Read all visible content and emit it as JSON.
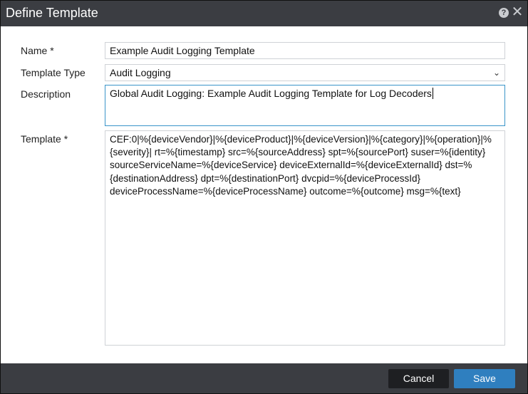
{
  "dialog": {
    "title": "Define Template",
    "help_icon": "question-circle-icon",
    "close_icon": "close-icon"
  },
  "form": {
    "name_label": "Name *",
    "name_value": "Example Audit Logging Template",
    "type_label": "Template Type",
    "type_value": "Audit Logging",
    "description_label": "Description",
    "description_value": "Global Audit Logging: Example Audit Logging Template for Log Decoders",
    "template_label": "Template *",
    "template_value": "CEF:0|%{deviceVendor}|%{deviceProduct}|%{deviceVersion}|%{category}|%{operation}|%{severity}| rt=%{timestamp} src=%{sourceAddress} spt=%{sourcePort} suser=%{identity} sourceServiceName=%{deviceService} deviceExternalId=%{deviceExternalId} dst=%{destinationAddress} dpt=%{destinationPort} dvcpid=%{deviceProcessId} deviceProcessName=%{deviceProcessName} outcome=%{outcome} msg=%{text}"
  },
  "footer": {
    "cancel_label": "Cancel",
    "save_label": "Save"
  },
  "colors": {
    "titlebar": "#3b3d42",
    "save_button": "#2f7fbf",
    "focus_border": "#3a94c9"
  }
}
